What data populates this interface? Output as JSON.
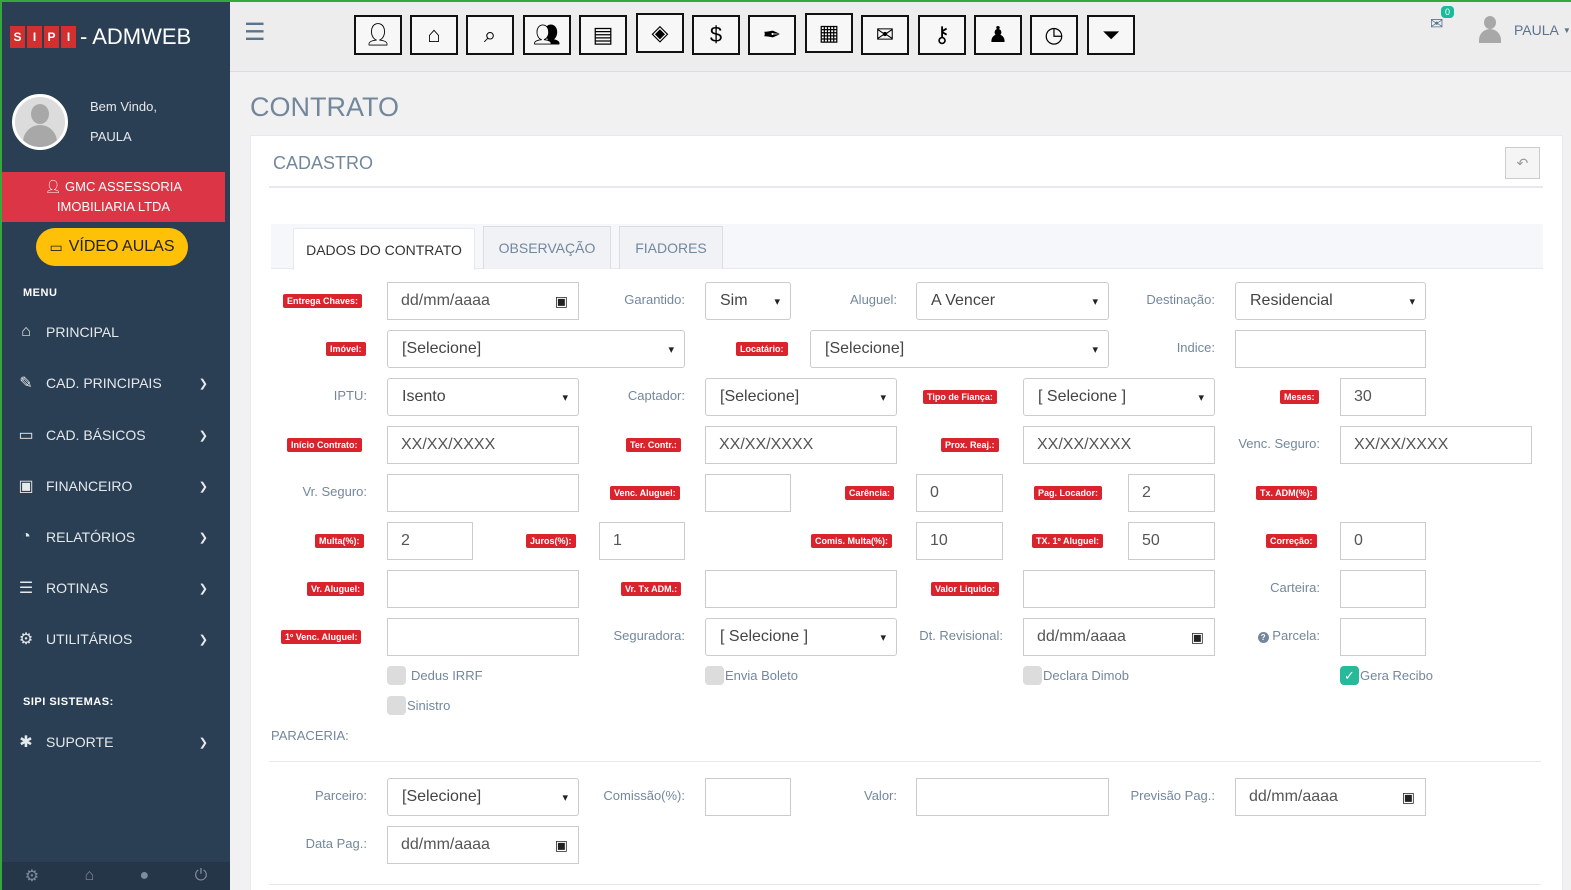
{
  "brand": {
    "letters": [
      "S",
      "I",
      "P",
      "I"
    ],
    "suffix": "- ADMWEB"
  },
  "profile": {
    "greeting": "Bem Vindo,",
    "name": "PAULA"
  },
  "company": {
    "line1": "GMC ASSESSORIA",
    "line2": "IMOBILIARIA LTDA"
  },
  "video_button": "VÍDEO AULAS",
  "menu_title": "MENU",
  "nav": [
    {
      "label": "PRINCIPAL",
      "icon": "home-icon",
      "glyph": "⌂",
      "chevron": false
    },
    {
      "label": "CAD. PRINCIPAIS",
      "icon": "edit-icon",
      "glyph": "✎",
      "chevron": true
    },
    {
      "label": "CAD. BÁSICOS",
      "icon": "folder-icon",
      "glyph": "▭",
      "chevron": true
    },
    {
      "label": "FINANCEIRO",
      "icon": "money-icon",
      "glyph": "▣",
      "chevron": true
    },
    {
      "label": "RELATÓRIOS",
      "icon": "pie-chart-icon",
      "glyph": "◔",
      "chevron": true
    },
    {
      "label": "ROTINAS",
      "icon": "database-icon",
      "glyph": "☰",
      "chevron": true
    },
    {
      "label": "UTILITÁRIOS",
      "icon": "cog-icon",
      "glyph": "⚙",
      "chevron": true
    }
  ],
  "section2_title": "SIPI SISTEMAS:",
  "support": {
    "label": "SUPORTE",
    "icon": "bug-icon",
    "glyph": "✱"
  },
  "topbar": {
    "mail_count": "0",
    "username": "PAULA"
  },
  "page_title": "CONTRATO",
  "panel_title": "CADASTRO",
  "tabs": [
    "DADOS DO CONTRATO",
    "OBSERVAÇÃO",
    "FIADORES"
  ],
  "form": {
    "entrega_chaves": {
      "label": "Entrega Chaves:",
      "value": "dd/mm/aaaa"
    },
    "garantido": {
      "label": "Garantido:",
      "value": "Sim"
    },
    "aluguel": {
      "label": "Aluguel:",
      "value": "A Vencer"
    },
    "destinacao": {
      "label": "Destinação:",
      "value": "Residencial"
    },
    "imovel": {
      "label": "Imóvel:",
      "value": "[Selecione]"
    },
    "locatario": {
      "label": "Locatário:",
      "value": "[Selecione]"
    },
    "indice": {
      "label": "Indice:",
      "value": ""
    },
    "iptu": {
      "label": "IPTU:",
      "value": "Isento"
    },
    "captador": {
      "label": "Captador:",
      "value": "[Selecione]"
    },
    "tipo_fianca": {
      "label": "Tipo de Fiança:",
      "value": "[ Selecione ]"
    },
    "meses": {
      "label": "Meses:",
      "value": "30"
    },
    "inicio_contrato": {
      "label": "Início Contrato:",
      "value": "XX/XX/XXXX"
    },
    "ter_contr": {
      "label": "Ter. Contr.:",
      "value": "XX/XX/XXXX"
    },
    "prox_reaj": {
      "label": "Prox. Reaj.:",
      "value": "XX/XX/XXXX"
    },
    "venc_seguro": {
      "label": "Venc. Seguro:",
      "value": "XX/XX/XXXX"
    },
    "vr_seguro": {
      "label": "Vr. Seguro:",
      "value": ""
    },
    "venc_aluguel": {
      "label": "Venc. Aluguel:",
      "value": ""
    },
    "carencia": {
      "label": "Carência:",
      "value": "0"
    },
    "pag_locador": {
      "label": "Pag. Locador:",
      "value": "2"
    },
    "tx_adm": {
      "label": "Tx. ADM(%):"
    },
    "multa": {
      "label": "Multa(%):",
      "value": "2"
    },
    "juros": {
      "label": "Juros(%):",
      "value": "1"
    },
    "comis_multa": {
      "label": "Comis. Multa(%):",
      "value": "10"
    },
    "tx_1_aluguel": {
      "label": "TX. 1º Aluguel:",
      "value": "50"
    },
    "correcao": {
      "label": "Correção:",
      "value": "0"
    },
    "vr_aluguel": {
      "label": "Vr. Aluguel:",
      "value": ""
    },
    "vr_tx_adm": {
      "label": "Vr. Tx ADM.:",
      "value": ""
    },
    "valor_liquido": {
      "label": "Valor Liquido:",
      "value": ""
    },
    "carteira": {
      "label": "Carteira:",
      "value": ""
    },
    "venc_1_aluguel": {
      "label": "1º Venc. Aluguel:",
      "value": ""
    },
    "seguradora": {
      "label": "Seguradora:",
      "value": "[ Selecione ]"
    },
    "dt_revisional": {
      "label": "Dt. Revisional:",
      "value": "dd/mm/aaaa"
    },
    "parcela": {
      "label": "Parcela:",
      "value": ""
    },
    "checkboxes": [
      {
        "label": "Dedus IRRF",
        "checked": false
      },
      {
        "label": "Envia Boleto",
        "checked": false
      },
      {
        "label": "Declara Dimob",
        "checked": false
      },
      {
        "label": "Gera Recibo",
        "checked": true
      },
      {
        "label": "Sinistro",
        "checked": false
      }
    ],
    "paraceria_title": "PARACERIA:",
    "parceiro": {
      "label": "Parceiro:",
      "value": "[Selecione]"
    },
    "comissao": {
      "label": "Comissão(%):",
      "value": ""
    },
    "valor": {
      "label": "Valor:",
      "value": ""
    },
    "previsao_pag": {
      "label": "Previsão Pag.:",
      "value": "dd/mm/aaaa"
    },
    "data_pag": {
      "label": "Data Pag.:",
      "value": "dd/mm/aaaa"
    }
  }
}
